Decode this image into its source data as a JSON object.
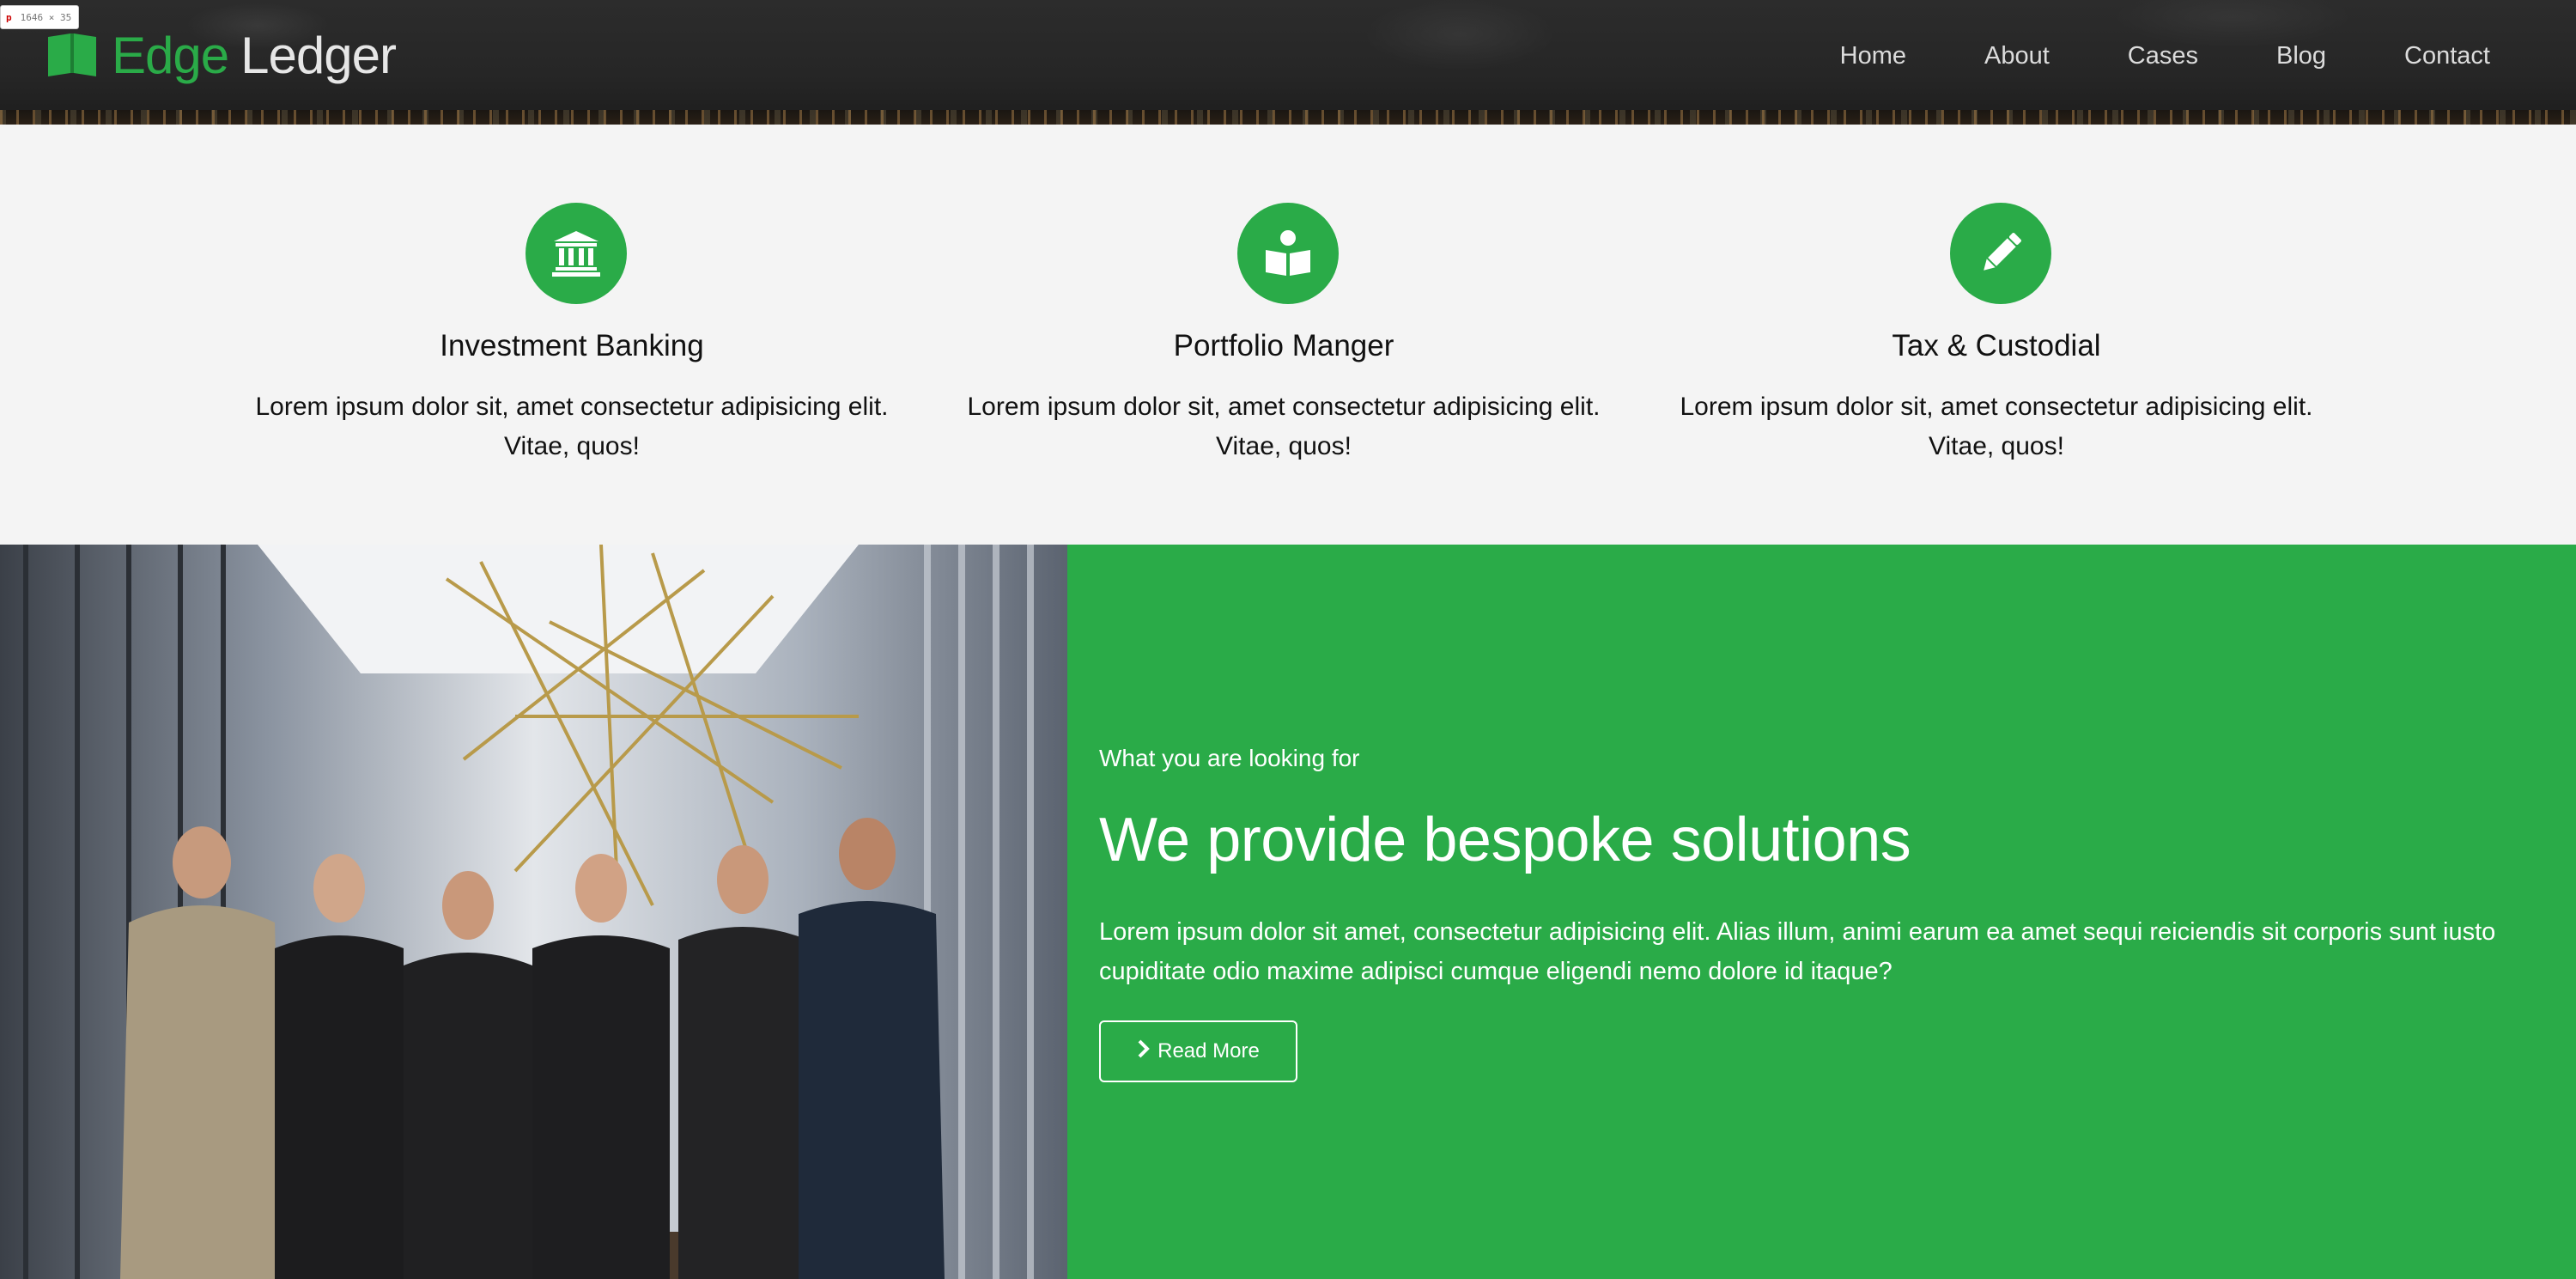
{
  "dev_tooltip": {
    "tag": "p",
    "size": "1646 × 35"
  },
  "brand": {
    "word1": "Edge",
    "word2": "Ledger",
    "accent": "#2aab48",
    "logo_icon": "open-book-icon"
  },
  "nav": {
    "items": [
      {
        "label": "Home"
      },
      {
        "label": "About"
      },
      {
        "label": "Cases"
      },
      {
        "label": "Blog"
      },
      {
        "label": "Contact"
      }
    ]
  },
  "services": [
    {
      "icon": "bank-icon",
      "title": "Investment Banking",
      "text": "Lorem ipsum dolor sit, amet consectetur adipisicing elit. Vitae, quos!"
    },
    {
      "icon": "reader-icon",
      "title": "Portfolio Manger",
      "text": "Lorem ipsum dolor sit, amet consectetur adipisicing elit. Vitae, quos!"
    },
    {
      "icon": "pencil-icon",
      "title": "Tax & Custodial",
      "text": "Lorem ipsum dolor sit, amet consectetur adipisicing elit. Vitae, quos!"
    }
  ],
  "feature": {
    "kicker": "What you are looking for",
    "heading": "We provide bespoke solutions",
    "body": "Lorem ipsum dolor sit amet, consectetur adipisicing elit. Alias illum, animi earum ea amet sequi reiciendis sit corporis sunt iusto cupiditate odio maxime adipisci cumque eligendi nemo dolore id itaque?",
    "button_label": "Read More",
    "button_icon": "chevron-right-icon",
    "background": "#2aab48"
  },
  "photo": {
    "subject": "team-photo"
  }
}
